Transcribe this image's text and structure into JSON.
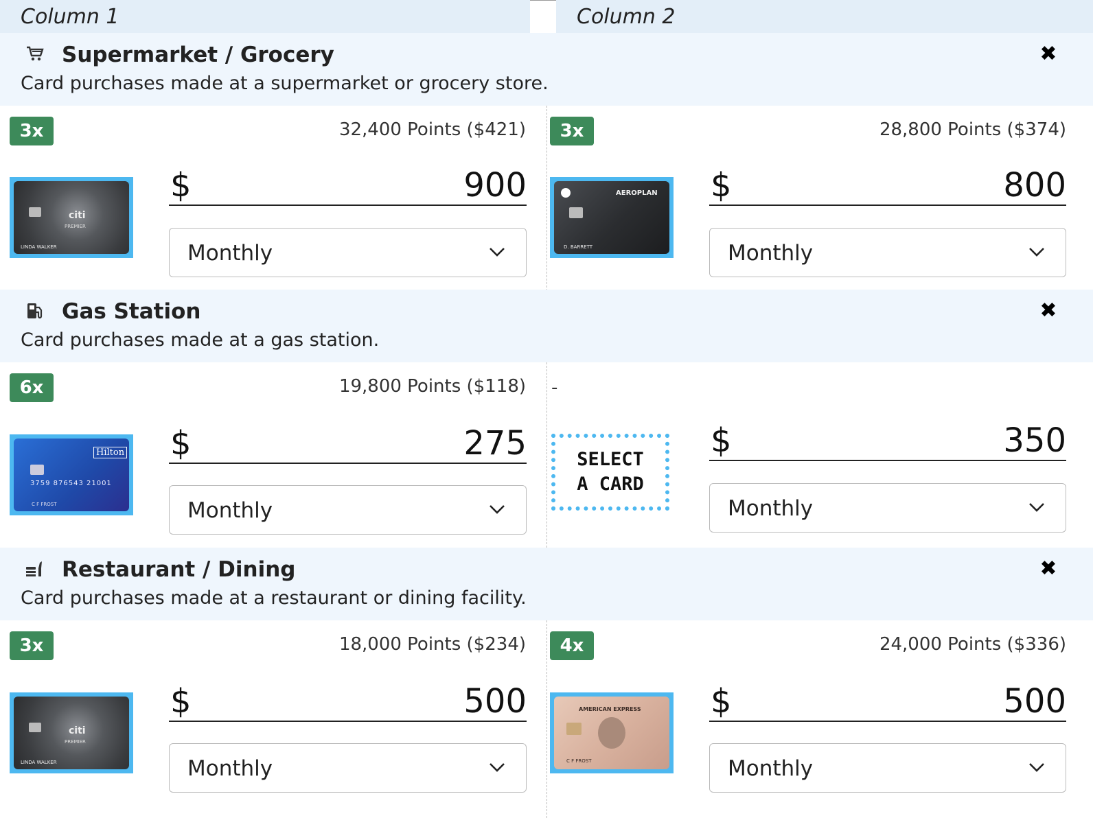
{
  "columns": [
    "Column 1",
    "Column 2"
  ],
  "categories": [
    {
      "title": "Supermarket / Grocery",
      "desc": "Card purchases made at a supermarket or grocery store.",
      "icon": "cart-icon",
      "close": "✖",
      "col1": {
        "multiplier": "3x",
        "points": "32,400 Points ($421)",
        "currency": "$",
        "amount": "900",
        "frequency": "Monthly",
        "card": "citi-premier-card"
      },
      "col2": {
        "multiplier": "3x",
        "points": "28,800 Points ($374)",
        "currency": "$",
        "amount": "800",
        "frequency": "Monthly",
        "card": "aeroplan-card"
      }
    },
    {
      "title": "Gas Station",
      "desc": "Card purchases made at a gas station.",
      "icon": "gas-pump-icon",
      "close": "✖",
      "col1": {
        "multiplier": "6x",
        "points": "19,800 Points ($118)",
        "currency": "$",
        "amount": "275",
        "frequency": "Monthly",
        "card": "hilton-honors-card"
      },
      "col2": {
        "points": "-",
        "select_label": "SELECT A CARD",
        "currency": "$",
        "amount": "350",
        "frequency": "Monthly"
      }
    },
    {
      "title": "Restaurant / Dining",
      "desc": "Card purchases made at a restaurant or dining facility.",
      "icon": "utensils-icon",
      "close": "✖",
      "col1": {
        "multiplier": "3x",
        "points": "18,000 Points ($234)",
        "currency": "$",
        "amount": "500",
        "frequency": "Monthly",
        "card": "citi-premier-card"
      },
      "col2": {
        "multiplier": "4x",
        "points": "24,000 Points ($336)",
        "currency": "$",
        "amount": "500",
        "frequency": "Monthly",
        "card": "amex-gold-card"
      }
    }
  ],
  "card_text": {
    "citi_brand": "citi",
    "citi_tier": "PREMIER",
    "citi_holder": "LINDA WALKER",
    "aero_brand": "AEROPLAN",
    "aero_holder": "D. BARRETT",
    "hilton_brand": "Hilton",
    "hilton_number": "3759 876543 21001",
    "hilton_holder": "C F FROST",
    "amex_brand": "AMERICAN EXPRESS",
    "amex_holder": "C F FROST"
  },
  "colors": {
    "badge": "#3d8a5a",
    "card_border": "#4db8f0",
    "category_bg": "#eff6fd",
    "header_bg": "#e3eef8"
  }
}
